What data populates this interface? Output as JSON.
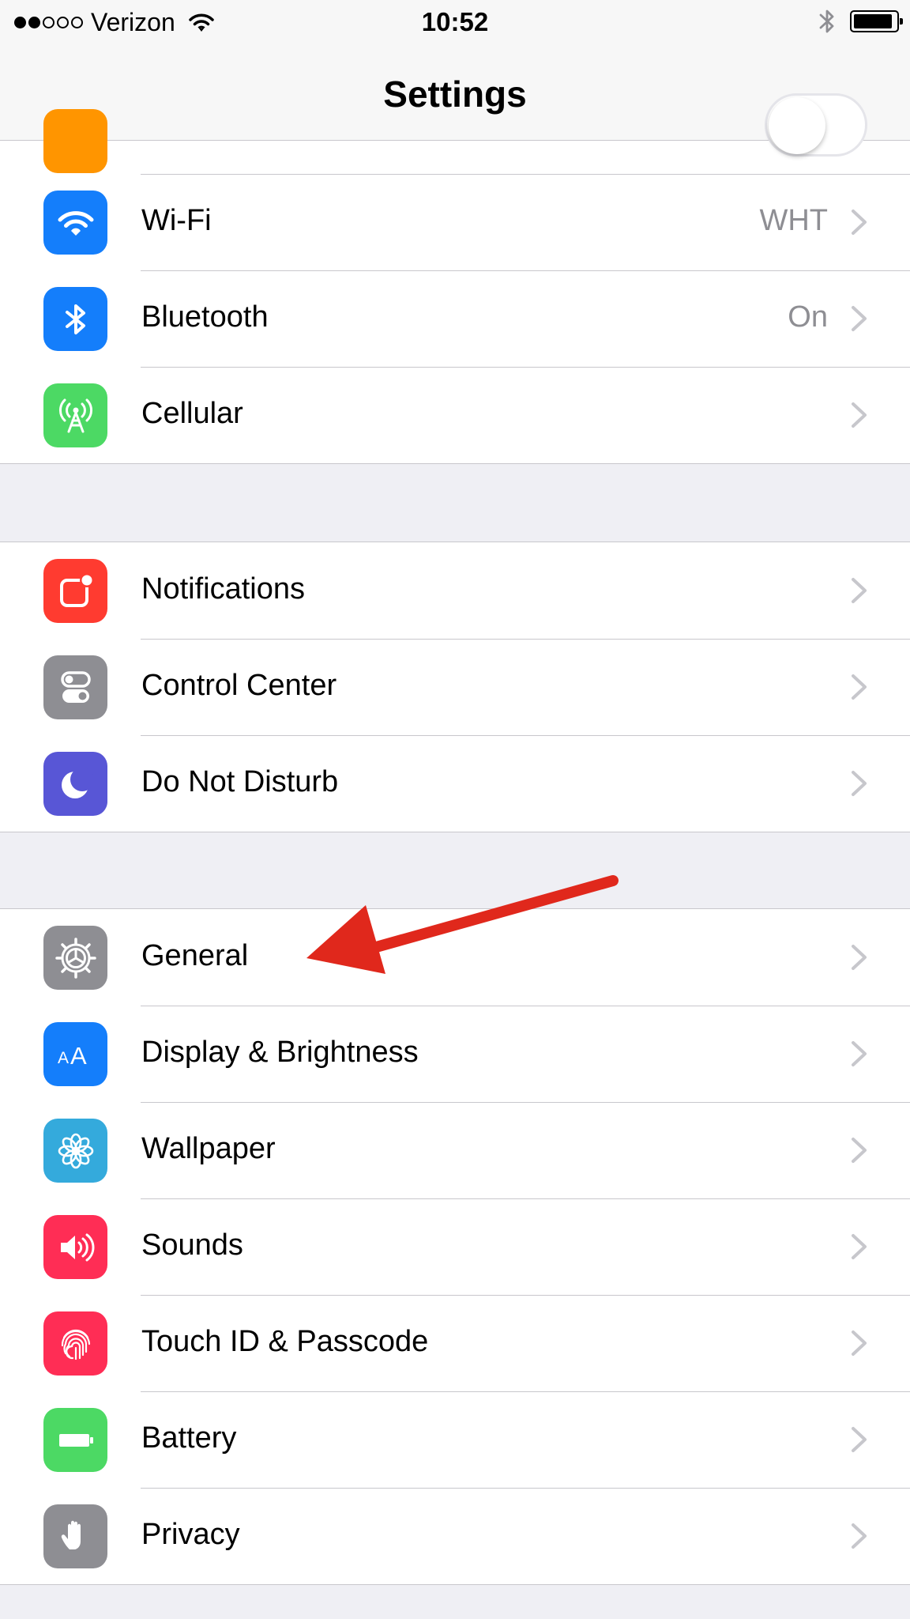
{
  "status_bar": {
    "carrier": "Verizon",
    "time": "10:52",
    "signal_bars_filled": 2,
    "signal_bars_total": 5
  },
  "nav": {
    "title": "Settings"
  },
  "groups": [
    {
      "rows": [
        {
          "key": "airplane-mode",
          "label": "",
          "partial": true,
          "toggle": "off",
          "icon": "airplane-icon",
          "color": "#ff9500"
        },
        {
          "key": "wifi",
          "label": "Wi-Fi",
          "detail": "WHT",
          "icon": "wifi-icon",
          "color": "#147efb"
        },
        {
          "key": "bluetooth",
          "label": "Bluetooth",
          "detail": "On",
          "icon": "bluetooth-icon",
          "color": "#147efb"
        },
        {
          "key": "cellular",
          "label": "Cellular",
          "detail": "",
          "icon": "cellular-antenna-icon",
          "color": "#4cd964"
        }
      ]
    },
    {
      "rows": [
        {
          "key": "notifications",
          "label": "Notifications",
          "detail": "",
          "icon": "notifications-icon",
          "color": "#ff3b30"
        },
        {
          "key": "control-center",
          "label": "Control Center",
          "detail": "",
          "icon": "control-center-icon",
          "color": "#8e8e93"
        },
        {
          "key": "do-not-disturb",
          "label": "Do Not Disturb",
          "detail": "",
          "icon": "moon-icon",
          "color": "#5856d6"
        }
      ]
    },
    {
      "rows": [
        {
          "key": "general",
          "label": "General",
          "detail": "",
          "icon": "gear-icon",
          "color": "#8e8e93"
        },
        {
          "key": "display-brightness",
          "label": "Display & Brightness",
          "detail": "",
          "icon": "text-size-icon",
          "color": "#147efb"
        },
        {
          "key": "wallpaper",
          "label": "Wallpaper",
          "detail": "",
          "icon": "flower-icon",
          "color": "#34aadc"
        },
        {
          "key": "sounds",
          "label": "Sounds",
          "detail": "",
          "icon": "speaker-icon",
          "color": "#ff2d55"
        },
        {
          "key": "touch-id-passcode",
          "label": "Touch ID & Passcode",
          "detail": "",
          "icon": "fingerprint-icon",
          "color": "#ff2d55"
        },
        {
          "key": "battery",
          "label": "Battery",
          "detail": "",
          "icon": "battery-icon",
          "color": "#4cd964"
        },
        {
          "key": "privacy",
          "label": "Privacy",
          "detail": "",
          "icon": "hand-icon",
          "color": "#8e8e93"
        }
      ]
    }
  ],
  "annotation": {
    "icon": "red-arrow-icon",
    "points_to": "general",
    "color": "#e0281c"
  }
}
